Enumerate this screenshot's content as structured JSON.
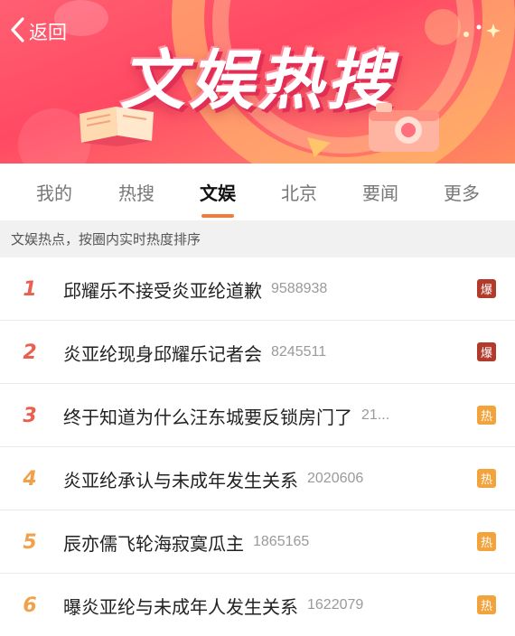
{
  "nav": {
    "back_label": "返回"
  },
  "banner": {
    "title": "文娱热搜"
  },
  "tabs": [
    {
      "label": "我的",
      "active": false
    },
    {
      "label": "热搜",
      "active": false
    },
    {
      "label": "文娱",
      "active": true
    },
    {
      "label": "北京",
      "active": false
    },
    {
      "label": "要闻",
      "active": false
    },
    {
      "label": "更多",
      "active": false
    }
  ],
  "subheader": "文娱热点，按圈内实时热度排序",
  "items": [
    {
      "rank": "1",
      "title": "邱耀乐不接受炎亚纶道歉",
      "count": "9588938",
      "badge": "爆"
    },
    {
      "rank": "2",
      "title": "炎亚纶现身邱耀乐记者会",
      "count": "8245511",
      "badge": "爆"
    },
    {
      "rank": "3",
      "title": "终于知道为什么汪东城要反锁房门了",
      "count": "21...",
      "badge": "热"
    },
    {
      "rank": "4",
      "title": "炎亚纶承认与未成年发生关系",
      "count": "2020606",
      "badge": "热"
    },
    {
      "rank": "5",
      "title": "辰亦儒飞轮海寂寞瓜主",
      "count": "1865165",
      "badge": "热"
    },
    {
      "rank": "6",
      "title": "曝炎亚纶与未成年人发生关系",
      "count": "1622079",
      "badge": "热"
    }
  ],
  "colors": {
    "rank_top": "#e9604f",
    "rank_mid": "#e9604f",
    "rank_low": "#f0a14a",
    "badge_bao": "#b23a2b",
    "badge_re": "#f2a33c",
    "tab_accent": "#f5793b"
  },
  "icons": {
    "back": "chevron-left-icon",
    "banner_book": "book-icon",
    "banner_camera": "camera-icon",
    "banner_sparkles": "sparkles-icon"
  }
}
